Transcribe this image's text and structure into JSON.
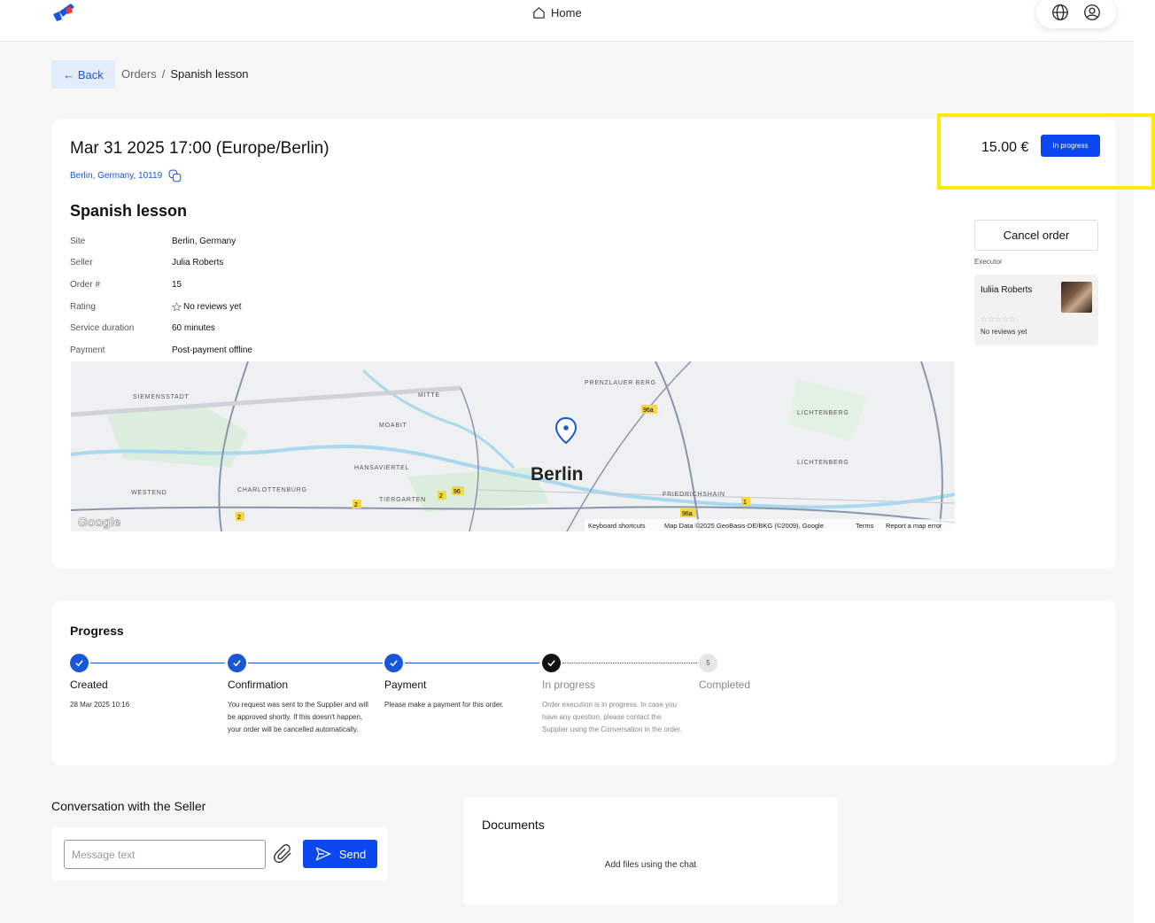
{
  "header": {
    "home_label": "Home",
    "icons": [
      "logo",
      "home-icon",
      "globe-icon",
      "user-icon"
    ]
  },
  "breadcrumb": {
    "back_label": "← Back",
    "items": [
      "Orders",
      "/",
      "Spanish lesson"
    ]
  },
  "order": {
    "datetime": "Mar 31 2025 17:00 (Europe/Berlin)",
    "address": "Berlin, Germany, 10119",
    "title": "Spanish lesson",
    "price": "15.00 €",
    "status": "In progress",
    "details": [
      {
        "label": "Site",
        "value": "Berlin, Germany"
      },
      {
        "label": "Seller",
        "value": "Julia Roberts"
      },
      {
        "label": "Order #",
        "value": "15"
      },
      {
        "label": "Rating",
        "value": "No reviews yet"
      },
      {
        "label": "Service duration",
        "value": "60 minutes"
      },
      {
        "label": "Payment",
        "value": "Post-payment offline"
      }
    ],
    "cancel_label": "Cancel order",
    "executor_label": "Executor",
    "executor": {
      "name": "Iuliia Roberts",
      "stars": "☆☆☆☆☆",
      "reviews": "No reviews yet"
    }
  },
  "map": {
    "city_label": "Berlin",
    "districts": [
      "SIEMENSSTADT",
      "MITTE",
      "PRENZLAUER BERG",
      "LICHTENBERG",
      "MOABIT",
      "HANSAVIERTEL",
      "LICHTENBERG",
      "WESTEND",
      "CHARLOTTENBURG",
      "TIERGARTEN",
      "FRIEDRICHSHAIN"
    ],
    "road_badges": [
      "96a",
      "2",
      "96",
      "2",
      "2",
      "96a",
      "1"
    ],
    "attribution": [
      "Keyboard shortcuts",
      "Map Data ©2025 GeoBasis-DE/BKG (©2009), Google",
      "Terms",
      "Report a map error"
    ],
    "google": "Google"
  },
  "progress": {
    "title": "Progress",
    "steps": [
      {
        "name": "Created",
        "desc": "28 Mar 2025 10:16",
        "state": "done"
      },
      {
        "name": "Confirmation",
        "desc": "You request was sent to the Supplier and will be approved shortly. If this doesn't happen, your order will be cancelled automatically.",
        "state": "done"
      },
      {
        "name": "Payment",
        "desc": "Please make a payment for this order.",
        "state": "done"
      },
      {
        "name": "In progress",
        "desc": "Order execution is in progress. In case you have any question, please contact the Supplier using the Conversation in the order.",
        "state": "current"
      },
      {
        "name": "Completed",
        "desc": "",
        "state": "todo",
        "number": "5"
      }
    ]
  },
  "conversation": {
    "title": "Conversation with the Seller",
    "placeholder": "Message text",
    "send_label": "Send"
  },
  "documents": {
    "title": "Documents",
    "empty": "Add files using the chat"
  },
  "colors": {
    "accent": "#0a47f0",
    "link": "#1a57d6",
    "highlight": "#ffeb00"
  }
}
